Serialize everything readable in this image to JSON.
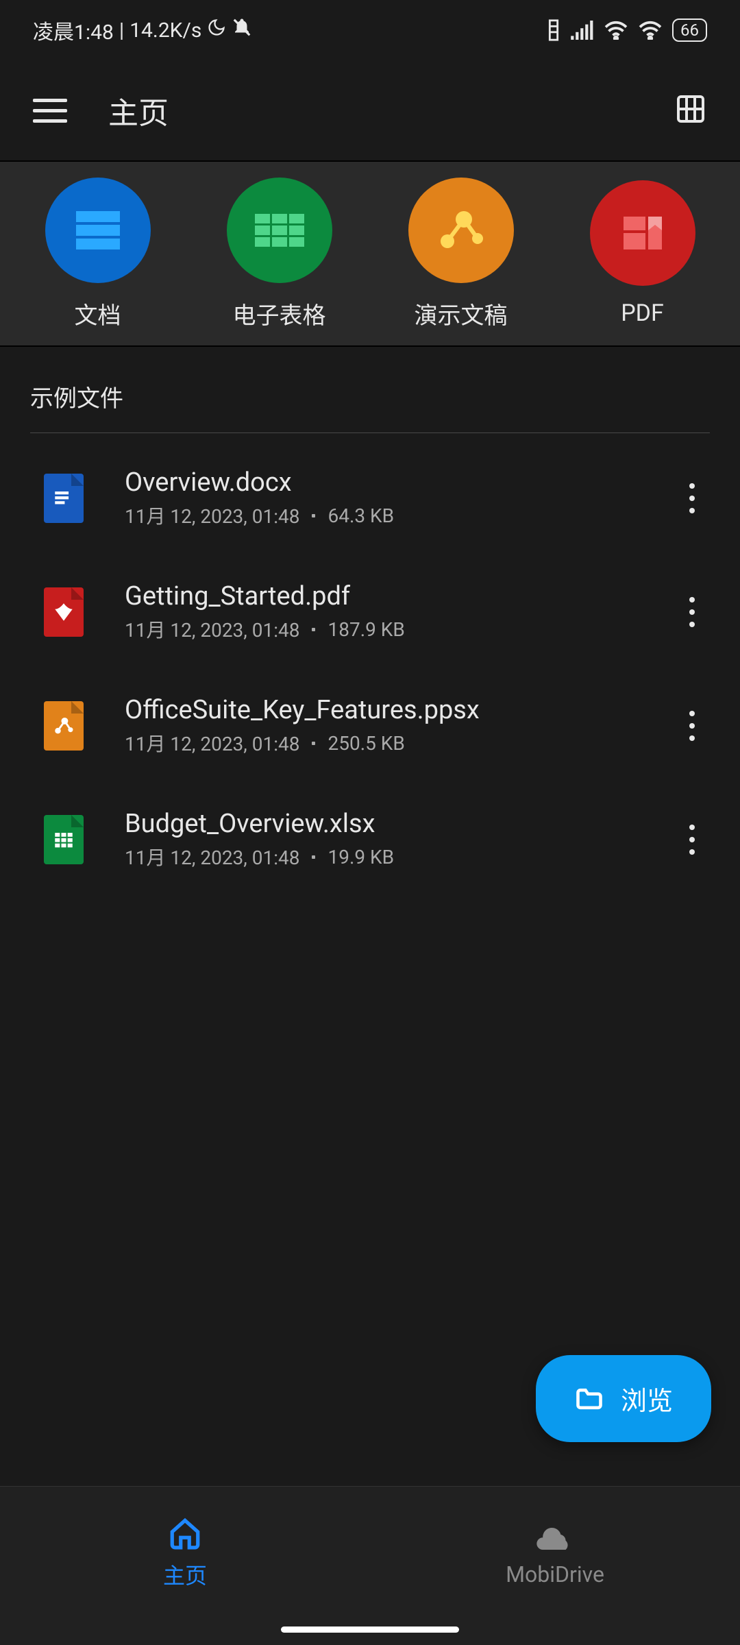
{
  "statusBar": {
    "time": "凌晨1:48",
    "speed": "14.2K/s",
    "battery": "66"
  },
  "appBar": {
    "title": "主页"
  },
  "categories": [
    {
      "key": "docs",
      "label": "文档"
    },
    {
      "key": "sheets",
      "label": "电子表格"
    },
    {
      "key": "slides",
      "label": "演示文稿"
    },
    {
      "key": "pdf",
      "label": "PDF"
    }
  ],
  "section": {
    "title": "示例文件"
  },
  "files": [
    {
      "name": "Overview.docx",
      "date": "11月 12, 2023, 01:48",
      "size": "64.3 KB",
      "type": "docx"
    },
    {
      "name": "Getting_Started.pdf",
      "date": "11月 12, 2023, 01:48",
      "size": "187.9 KB",
      "type": "pdf"
    },
    {
      "name": "OfficeSuite_Key_Features.ppsx",
      "date": "11月 12, 2023, 01:48",
      "size": "250.5 KB",
      "type": "ppsx"
    },
    {
      "name": "Budget_Overview.xlsx",
      "date": "11月 12, 2023, 01:48",
      "size": "19.9 KB",
      "type": "xlsx"
    }
  ],
  "fab": {
    "label": "浏览"
  },
  "bottomNav": {
    "home": "主页",
    "mobidrive": "MobiDrive"
  }
}
